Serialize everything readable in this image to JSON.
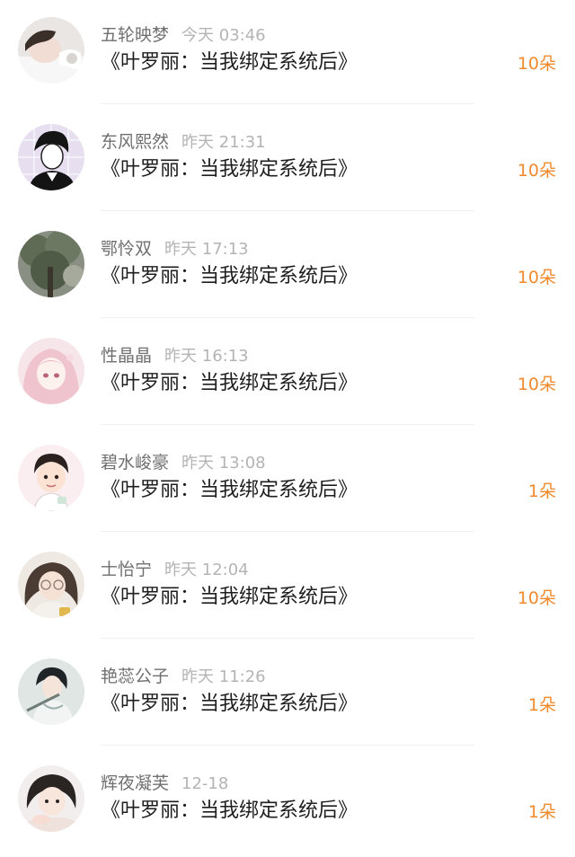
{
  "gifts": [
    {
      "name": "五轮映梦",
      "time": "今天 03:46",
      "book": "《叶罗丽：当我绑定系统后》",
      "count": "10朵"
    },
    {
      "name": "东风熙然",
      "time": "昨天 21:31",
      "book": "《叶罗丽：当我绑定系统后》",
      "count": "10朵"
    },
    {
      "name": "鄂怜双",
      "time": "昨天 17:13",
      "book": "《叶罗丽：当我绑定系统后》",
      "count": "10朵"
    },
    {
      "name": "性晶晶",
      "time": "昨天 16:13",
      "book": "《叶罗丽：当我绑定系统后》",
      "count": "10朵"
    },
    {
      "name": "碧水峻豪",
      "time": "昨天 13:08",
      "book": "《叶罗丽：当我绑定系统后》",
      "count": "1朵"
    },
    {
      "name": "士怡宁",
      "time": "昨天 12:04",
      "book": "《叶罗丽：当我绑定系统后》",
      "count": "10朵"
    },
    {
      "name": "艳蕊公子",
      "time": "昨天 11:26",
      "book": "《叶罗丽：当我绑定系统后》",
      "count": "1朵"
    },
    {
      "name": "辉夜凝芙",
      "time": "12-18",
      "book": "《叶罗丽：当我绑定系统后》",
      "count": "1朵"
    }
  ],
  "colors": {
    "username": "#6f6f6f",
    "timestamp": "#b4b4b4",
    "book_title": "#1e1e1e",
    "gift_count": "#f08a2c",
    "divider": "#f1f1f1"
  }
}
